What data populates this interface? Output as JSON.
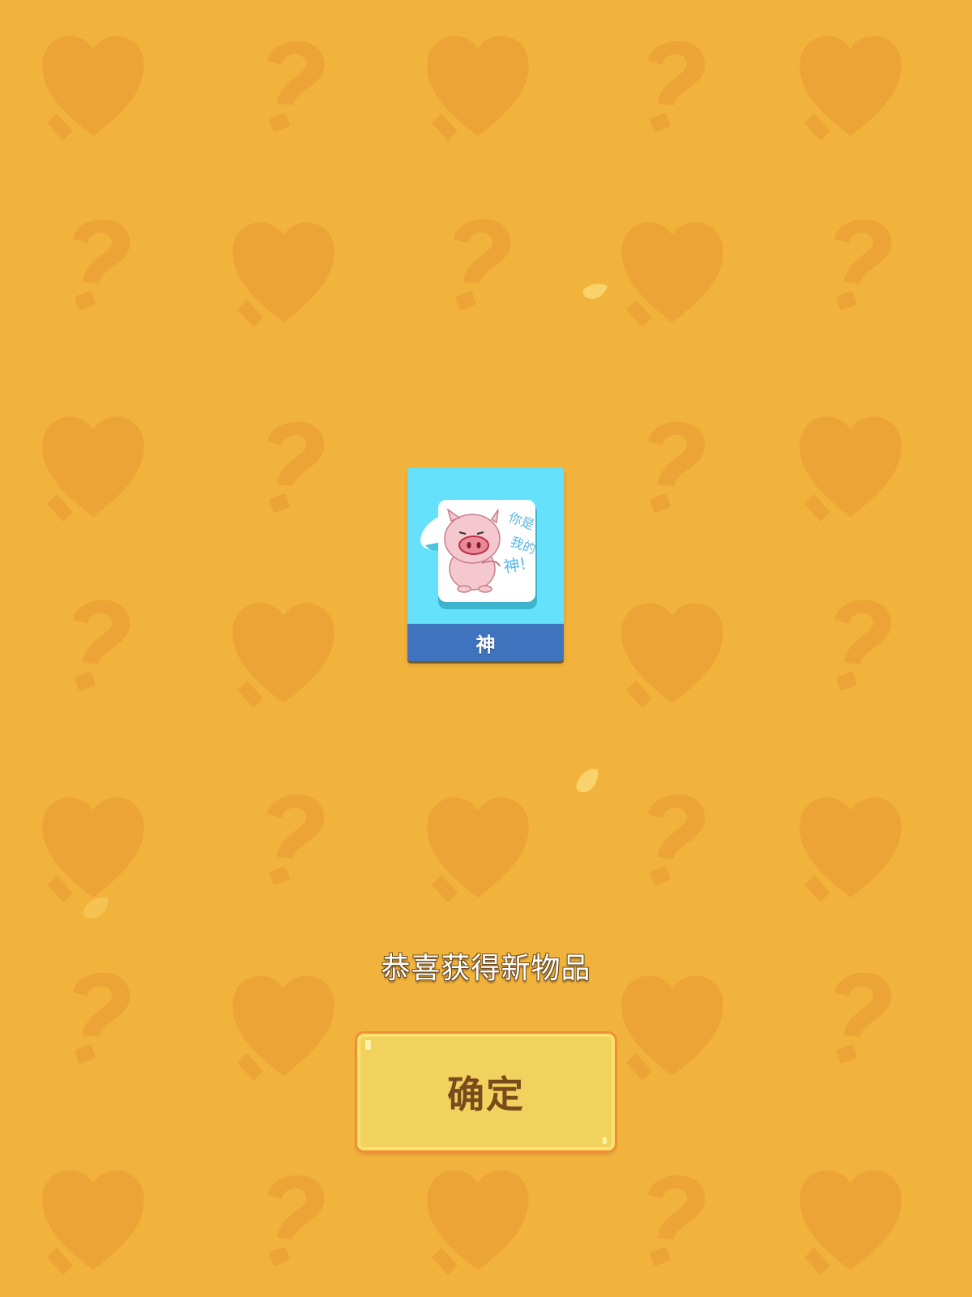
{
  "reward": {
    "item_name": "神",
    "sticker_text": "你是我的神!"
  },
  "message": {
    "congrats": "恭喜获得新物品"
  },
  "actions": {
    "confirm_label": "确定"
  },
  "colors": {
    "background": "#f2b33c",
    "card_top": "#66e1fb",
    "card_name_bar": "#3f73be",
    "button_fill": "#f2d25e",
    "button_text": "#7a4a1c"
  },
  "icons": {
    "background_pattern": [
      "heart-icon",
      "question-mark-icon"
    ],
    "sticker": "pig-sticker-icon"
  }
}
